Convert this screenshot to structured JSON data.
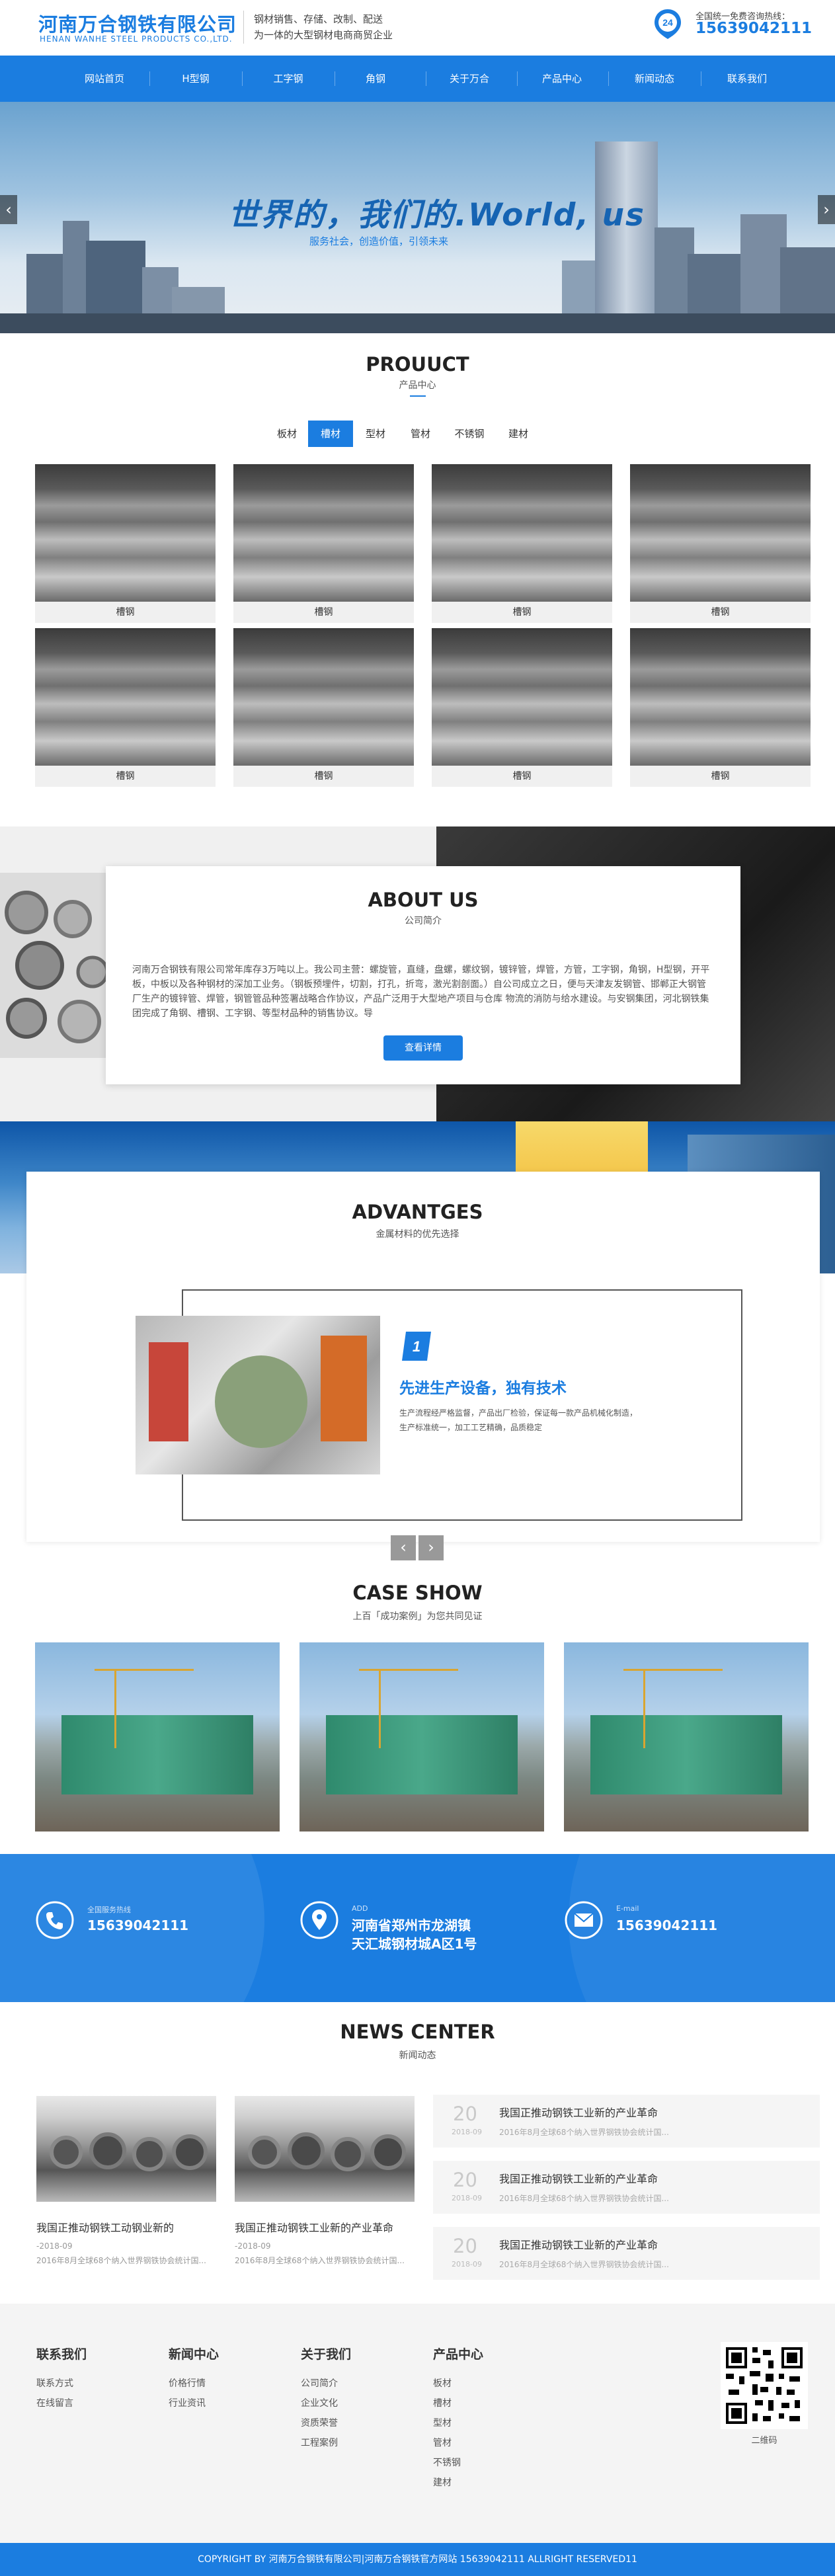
{
  "header": {
    "logo_cn": "河南万合钢铁有限公司",
    "logo_en": "HENAN WANHE STEEL PRODUCTS CO.,LTD.",
    "slogan_line1": "钢材销售、存储、改制、配送",
    "slogan_line2": "为一体的大型钢材电商商贸企业",
    "hotline_badge": "24",
    "hotline_label": "全国统一免费咨询热线：",
    "hotline_phone": "15639042111"
  },
  "nav": [
    "网站首页",
    "H型钢",
    "工字钢",
    "角钢",
    "关于万合",
    "产品中心",
    "新闻动态",
    "联系我们"
  ],
  "banner": {
    "title": "世界的，我们的.World, us",
    "subtitle": "服务社会，创造价值，引领未来",
    "prev": "‹",
    "next": "›"
  },
  "products": {
    "title": "PROUUCT",
    "subtitle": "产品中心",
    "tabs": [
      "板材",
      "槽材",
      "型材",
      "管材",
      "不锈钢",
      "建材"
    ],
    "active_tab": 1,
    "items": [
      "槽钢",
      "槽钢",
      "槽钢",
      "槽钢",
      "槽钢",
      "槽钢",
      "槽钢",
      "槽钢"
    ]
  },
  "about": {
    "title": "ABOUT US",
    "subtitle": "公司简介",
    "text": "河南万合钢铁有限公司常年库存3万吨以上。我公司主营：螺旋管，直缝，盘螺，螺纹钢，镀锌管，焊管，方管，工字钢，角钢，H型钢，开平板，中板以及各种钢材的深加工业务。（钢板预埋件，切割，打孔，折弯，激光割剖面。）自公司成立之日，便与天津友发钢管、邯郸正大钢管厂生产的镀锌管、焊管，钢管管品种签署战略合作协议，产品广泛用于大型地产项目与仓库 物流的消防与给水建设。与安钢集团，河北钢铁集团完成了角钢、槽钢、工字钢、等型材品种的销售协议。导",
    "button": "查看详情"
  },
  "advantages": {
    "title": "ADVANTGES",
    "subtitle": "金属材料的优先选择",
    "number": "1",
    "heading": "先进生产设备，独有技术",
    "desc": "生产流程经严格监督，产品出厂检验，保证每一款产品机械化制造，生产标准统一，加工工艺精确，品质稳定",
    "prev": "‹",
    "next": "›"
  },
  "cases": {
    "title": "CASE SHOW",
    "subtitle": "上百「成功案例」为您共同见证"
  },
  "contact": {
    "phone_label": "全国服务热线",
    "phone": "15639042111",
    "addr_label": "ADD",
    "addr_line1": "河南省郑州市龙湖镇",
    "addr_line2": "天汇城钢材城A区1号",
    "mail_label": "E-mail",
    "mail": "15639042111"
  },
  "news": {
    "title": "NEWS CENTER",
    "subtitle": "新闻动态",
    "cards": [
      {
        "title": "我国正推动钢铁工动钢业新的",
        "date": "-2018-09",
        "summary": "2016年8月全球68个纳入世界钢铁协会统计国..."
      },
      {
        "title": "我国正推动钢铁工业新的产业革命",
        "date": "-2018-09",
        "summary": "2016年8月全球68个纳入世界钢铁协会统计国..."
      }
    ],
    "list": [
      {
        "day": "20",
        "ym": "2018-09",
        "title": "我国正推动钢铁工业新的产业革命",
        "summary": "2016年8月全球68个纳入世界钢铁协会统计国..."
      },
      {
        "day": "20",
        "ym": "2018-09",
        "title": "我国正推动钢铁工业新的产业革命",
        "summary": "2016年8月全球68个纳入世界钢铁协会统计国..."
      },
      {
        "day": "20",
        "ym": "2018-09",
        "title": "我国正推动钢铁工业新的产业革命",
        "summary": "2016年8月全球68个纳入世界钢铁协会统计国..."
      }
    ]
  },
  "footer": {
    "columns": [
      {
        "title": "联系我们",
        "links": [
          "联系方式",
          "在线留言"
        ]
      },
      {
        "title": "新闻中心",
        "links": [
          "价格行情",
          "行业资讯"
        ]
      },
      {
        "title": "关于我们",
        "links": [
          "公司简介",
          "企业文化",
          "资质荣誉",
          "工程案例"
        ]
      },
      {
        "title": "产品中心",
        "links": [
          "板材",
          "槽材",
          "型材",
          "管材",
          "不锈钢",
          "建材"
        ]
      }
    ],
    "qr_caption": "二维码",
    "copyright": "COPYRIGHT BY 河南万合钢铁有限公司|河南万合钢铁官方网站 15639042111 ALLRIGHT RESERVED11"
  },
  "colors": {
    "brand": "#1b7de0",
    "footer_bg": "#f4f4f4"
  }
}
